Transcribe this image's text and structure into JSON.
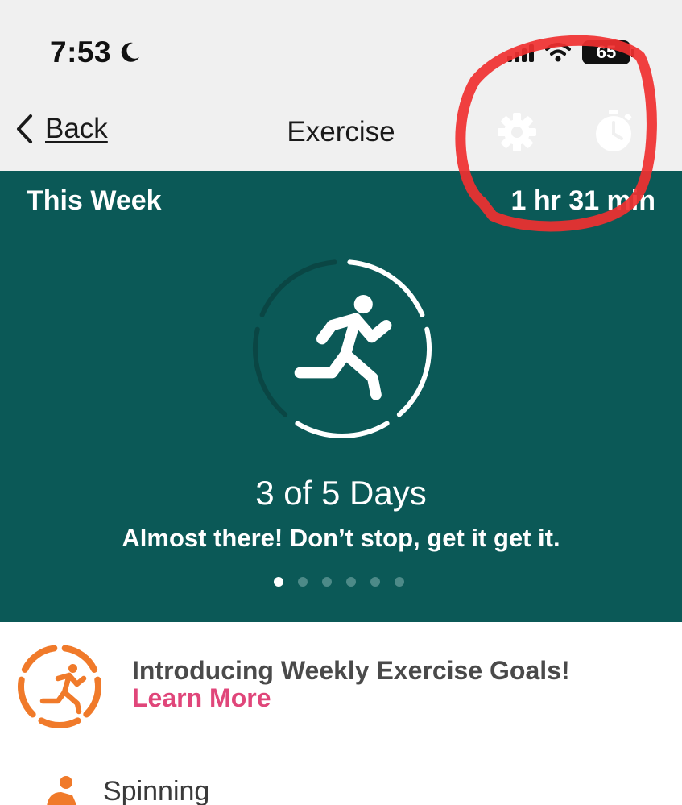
{
  "status_bar": {
    "time": "7:53",
    "battery": "65"
  },
  "nav": {
    "back_label": "Back",
    "title": "Exercise",
    "icons": [
      "gear-icon",
      "stopwatch-icon"
    ]
  },
  "summary": {
    "period_label": "This Week",
    "total_time": "1 hr 31 min",
    "days_text": "3 of 5 Days",
    "days_done": 3,
    "days_goal": 5,
    "message": "Almost there! Don’t stop, get it get it.",
    "page_count": 6,
    "active_page": 0
  },
  "promo": {
    "title": "Introducing Weekly Exercise Goals!",
    "link": "Learn More"
  },
  "activities": [
    {
      "label": "Spinning",
      "icon": "spinning-icon"
    }
  ],
  "colors": {
    "hero_bg": "#0b5957",
    "accent_orange": "#f07a2a",
    "link_pink": "#e0467a",
    "annotation_red": "#f03030"
  }
}
